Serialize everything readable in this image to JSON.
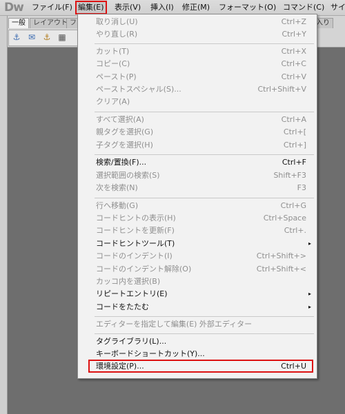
{
  "app": {
    "logo": "Dw"
  },
  "menubar": {
    "items": [
      {
        "label": "ファイル(F)"
      },
      {
        "label": "編集(E)"
      },
      {
        "label": "表示(V)"
      },
      {
        "label": "挿入(I)"
      },
      {
        "label": "修正(M)"
      },
      {
        "label": "フォーマット(O)"
      },
      {
        "label": "コマンド(C)"
      },
      {
        "label": "サイ"
      }
    ]
  },
  "toolbar": {
    "tabs": [
      {
        "label": "一般"
      },
      {
        "label": "レイアウト"
      },
      {
        "label": "フ"
      }
    ],
    "right_tab": "に入り",
    "icons": [
      "hyperlink-icon",
      "email-link-icon",
      "anchor-icon",
      "table-icon"
    ]
  },
  "edit_menu": {
    "items": [
      {
        "label": "取り消し(U)",
        "shortcut": "Ctrl+Z",
        "enabled": false
      },
      {
        "label": "やり直し(R)",
        "shortcut": "Ctrl+Y",
        "enabled": false
      },
      {
        "label": "カット(T)",
        "shortcut": "Ctrl+X",
        "enabled": false
      },
      {
        "label": "コピー(C)",
        "shortcut": "Ctrl+C",
        "enabled": false
      },
      {
        "label": "ペースト(P)",
        "shortcut": "Ctrl+V",
        "enabled": false
      },
      {
        "label": "ペーストスペシャル(S)...",
        "shortcut": "Ctrl+Shift+V",
        "enabled": false
      },
      {
        "label": "クリア(A)",
        "shortcut": "",
        "enabled": false
      },
      {
        "label": "すべて選択(A)",
        "shortcut": "Ctrl+A",
        "enabled": false
      },
      {
        "label": "親タグを選択(G)",
        "shortcut": "Ctrl+[",
        "enabled": false
      },
      {
        "label": "子タグを選択(H)",
        "shortcut": "Ctrl+]",
        "enabled": false
      },
      {
        "label": "検索/置換(F)...",
        "shortcut": "Ctrl+F",
        "enabled": true
      },
      {
        "label": "選択範囲の検索(S)",
        "shortcut": "Shift+F3",
        "enabled": false
      },
      {
        "label": "次を検索(N)",
        "shortcut": "F3",
        "enabled": false
      },
      {
        "label": "行へ移動(G)",
        "shortcut": "Ctrl+G",
        "enabled": false
      },
      {
        "label": "コードヒントの表示(H)",
        "shortcut": "Ctrl+Space",
        "enabled": false
      },
      {
        "label": "コードヒントを更新(F)",
        "shortcut": "Ctrl+.",
        "enabled": false
      },
      {
        "label": "コードヒントツール(T)",
        "shortcut": "",
        "enabled": true,
        "submenu": true
      },
      {
        "label": "コードのインデント(I)",
        "shortcut": "Ctrl+Shift+>",
        "enabled": false
      },
      {
        "label": "コードのインデント解除(O)",
        "shortcut": "Ctrl+Shift+<",
        "enabled": false
      },
      {
        "label": "カッコ内を選択(B)",
        "shortcut": "",
        "enabled": false
      },
      {
        "label": "リピートエントリ(E)",
        "shortcut": "",
        "enabled": true,
        "submenu": true
      },
      {
        "label": "コードをたたむ",
        "shortcut": "",
        "enabled": true,
        "submenu": true
      },
      {
        "label": "エディターを指定して編集(E) 外部エディター",
        "shortcut": "",
        "enabled": false
      },
      {
        "label": "タグライブラリ(L)...",
        "shortcut": "",
        "enabled": true
      },
      {
        "label": "キーボードショートカット(Y)...",
        "shortcut": "",
        "enabled": true
      },
      {
        "label": "環境設定(P)...",
        "shortcut": "Ctrl+U",
        "enabled": true
      }
    ],
    "submenu_arrow": "▸"
  }
}
